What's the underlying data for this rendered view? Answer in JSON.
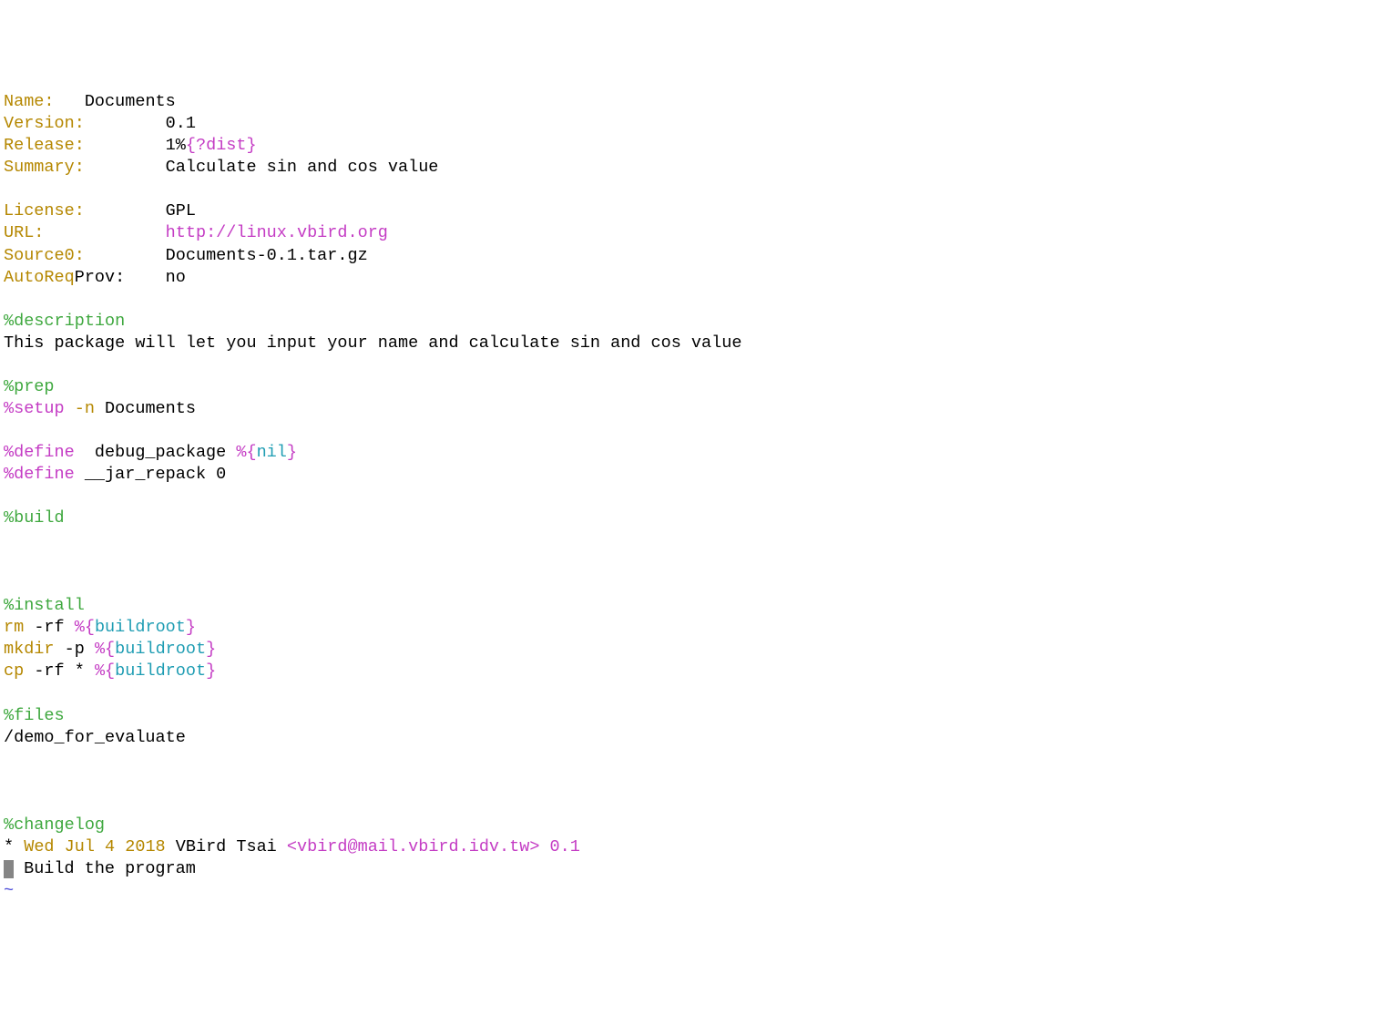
{
  "header": {
    "name_key": "Name:",
    "name_val": "Documents",
    "version_key": "Version:",
    "version_val": "0.1",
    "release_key": "Release:",
    "release_val_pre": "1%",
    "release_brace_open": "{",
    "release_var": "?dist",
    "release_brace_close": "}",
    "summary_key": "Summary:",
    "summary_val": "Calculate sin and cos value",
    "license_key": "License:",
    "license_val": "GPL",
    "url_key": "URL:",
    "url_val": "http://linux.vbird.org",
    "source0_key": "Source0:",
    "source0_val": "Documents-0.1.tar.gz",
    "autoreq_key1": "AutoReq",
    "autoreq_key2": "Prov:",
    "autoreq_val": "no"
  },
  "description": {
    "directive": "%description",
    "text": "This package will let you input your name and calculate sin and cos value"
  },
  "prep": {
    "directive": "%prep",
    "setup_macro": "%setup",
    "setup_flag": " -n",
    "setup_arg": " Documents"
  },
  "defines": {
    "define1_macro": "%define",
    "define1_name": "  debug_package ",
    "define1_pct_brace": "%{",
    "define1_var": "nil",
    "define1_close": "}",
    "define2_macro": "%define",
    "define2_text": " __jar_repack 0"
  },
  "build": {
    "directive": "%build"
  },
  "install": {
    "directive": "%install",
    "rm_cmd": "rm",
    "rm_flags": " -rf ",
    "mkdir_cmd": "mkdir",
    "mkdir_flags": " -p ",
    "cp_cmd": "cp",
    "cp_flags": " -rf * ",
    "pct_brace": "%{",
    "buildroot": "buildroot",
    "close": "}"
  },
  "files": {
    "directive": "%files",
    "path": "/demo_for_evaluate"
  },
  "changelog": {
    "directive": "%changelog",
    "star": "* ",
    "date": "Wed Jul 4 2018",
    "author": " VBird Tsai ",
    "email": "<vbird@mail.vbird.idv.tw>",
    "space": " ",
    "version": "0.1",
    "entry": " Build the program"
  },
  "tilde": "~"
}
